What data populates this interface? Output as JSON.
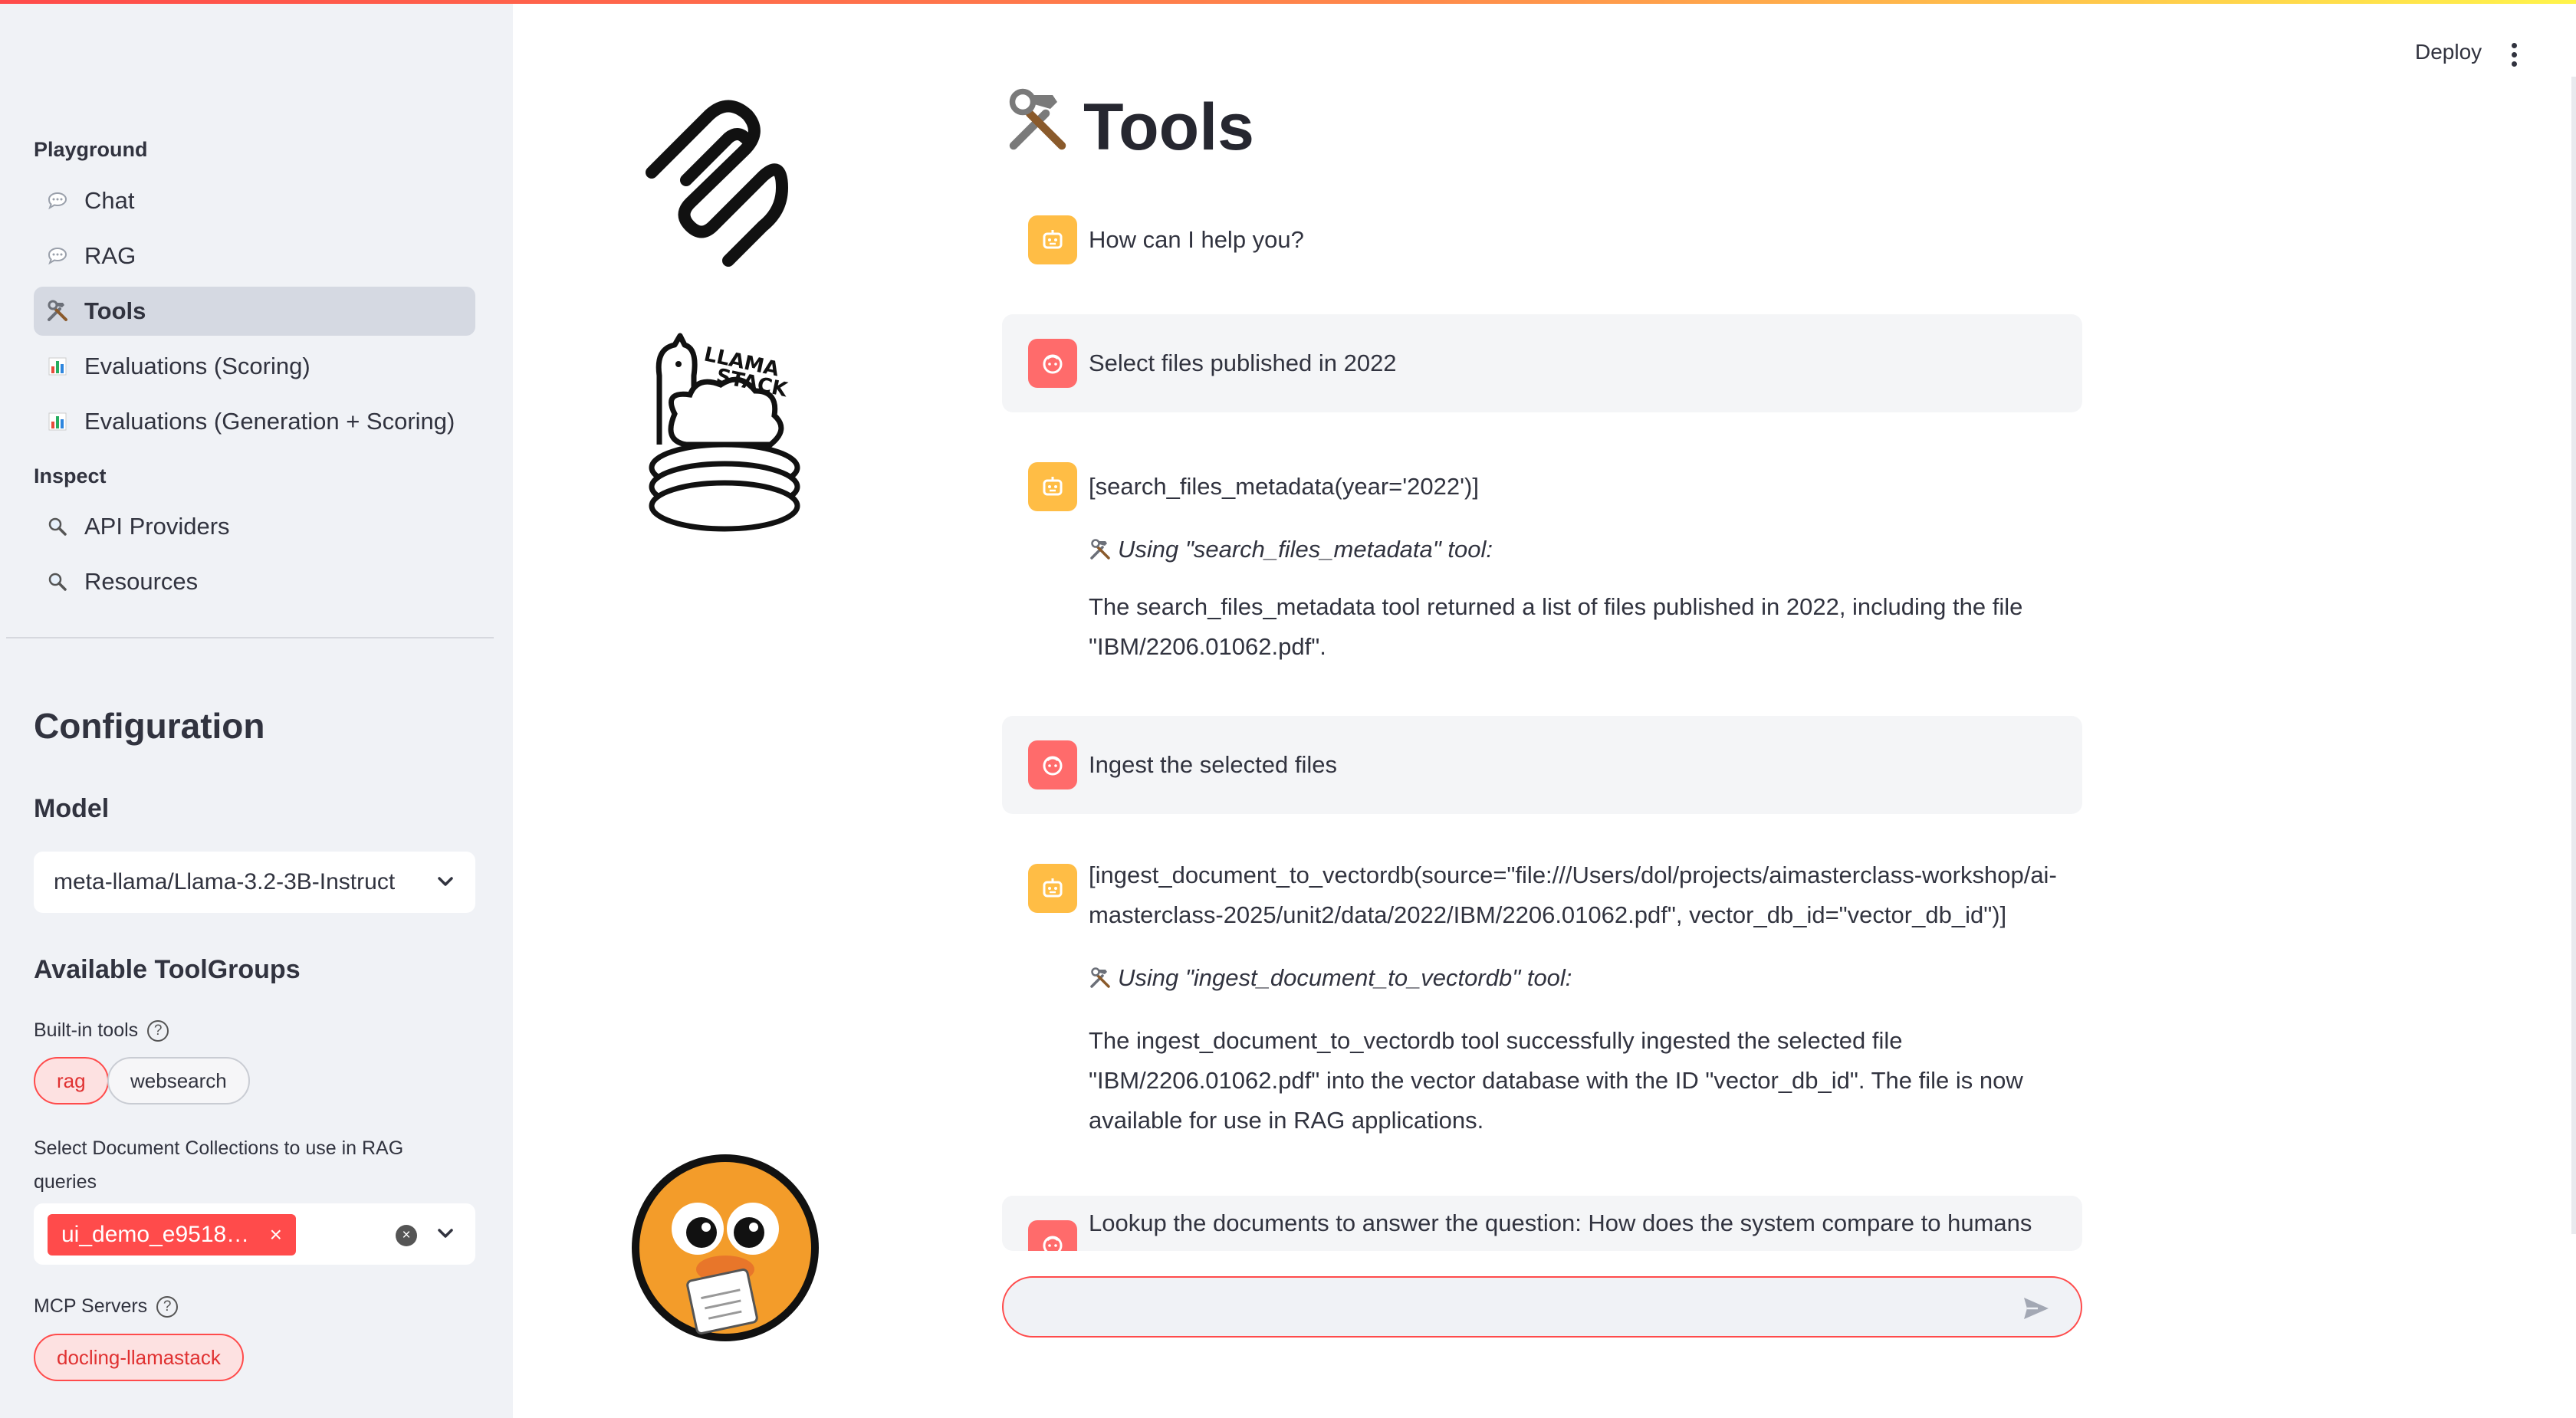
{
  "sidebar": {
    "playground_label": "Playground",
    "inspect_label": "Inspect",
    "items": [
      {
        "label": "Chat",
        "icon": "speech-bubble-icon"
      },
      {
        "label": "RAG",
        "icon": "speech-bubble-icon"
      },
      {
        "label": "Tools",
        "icon": "hammer-wrench-icon",
        "active": true
      },
      {
        "label": "Evaluations (Scoring)",
        "icon": "bar-chart-icon"
      },
      {
        "label": "Evaluations (Generation + Scoring)",
        "icon": "bar-chart-icon"
      },
      {
        "label": "API Providers",
        "icon": "magnifier-icon"
      },
      {
        "label": "Resources",
        "icon": "magnifier-icon"
      }
    ],
    "configuration_title": "Configuration",
    "model_title": "Model",
    "model_value": "meta-llama/Llama-3.2-3B-Instruct",
    "toolgroups_title": "Available ToolGroups",
    "builtin_label": "Built-in tools",
    "builtin_tools": [
      {
        "label": "rag",
        "selected": true
      },
      {
        "label": "websearch",
        "selected": false
      }
    ],
    "collections_label": "Select Document Collections to use in RAG queries",
    "collection_tag": "ui_demo_e9518…",
    "mcp_label": "MCP Servers",
    "mcp_servers": [
      {
        "label": "docling-llamastack",
        "selected": true
      }
    ]
  },
  "header": {
    "deploy_label": "Deploy"
  },
  "main": {
    "title": "Tools",
    "messages": [
      {
        "role": "assistant",
        "lines": [
          "How can I help you?"
        ]
      },
      {
        "role": "user",
        "lines": [
          "Select files published in 2022"
        ]
      },
      {
        "role": "assistant",
        "lines": [
          "[search_files_metadata(year='2022')]"
        ],
        "tool_note": "Using \"search_files_metadata\" tool:",
        "result": [
          "The search_files_metadata tool returned a list of files published in 2022, including the file",
          "\"IBM/2206.01062.pdf\"."
        ]
      },
      {
        "role": "user",
        "lines": [
          "Ingest the selected files"
        ]
      },
      {
        "role": "assistant",
        "lines": [
          "[ingest_document_to_vectordb(source=\"file:///Users/dol/projects/aimasterclass-workshop/ai-",
          "masterclass-2025/unit2/data/2022/IBM/2206.01062.pdf\", vector_db_id=\"vector_db_id\")]"
        ],
        "tool_note": "Using \"ingest_document_to_vectordb\" tool:",
        "result": [
          "The ingest_document_to_vectordb tool successfully ingested the selected file",
          "\"IBM/2206.01062.pdf\" into the vector database with the ID \"vector_db_id\". The file is now",
          "available for use in RAG applications."
        ]
      },
      {
        "role": "user",
        "lines": [
          "Lookup the documents to answer the question: How does the system compare to humans"
        ]
      }
    ],
    "chat_input_placeholder": ""
  },
  "logos": {
    "llama_stack_text_1": "LLAMA",
    "llama_stack_text_2": "STACK"
  },
  "colors": {
    "accent": "#ff4b4b",
    "assistant_avatar": "#ffbd45",
    "user_avatar": "#ff6b6b",
    "sidebar_bg": "#f0f2f6"
  }
}
